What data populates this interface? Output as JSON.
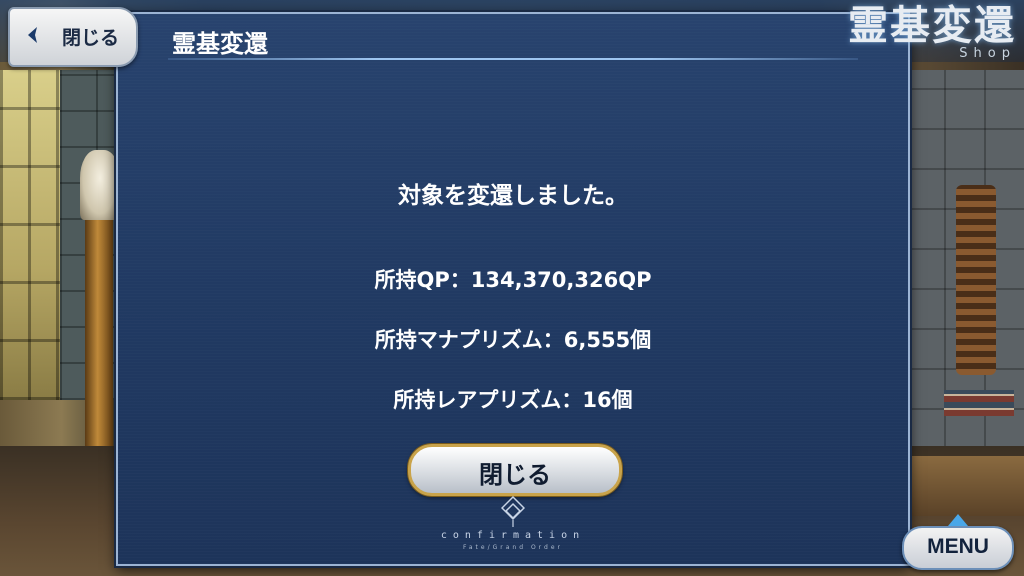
{
  "header": {
    "close_label": "閉じる",
    "shop_title": "霊基変還",
    "shop_subtitle": "Shop"
  },
  "dialog": {
    "title": "霊基変還",
    "message": "対象を変還しました。",
    "qp_line": "所持QP：134,370,326QP",
    "mana_prism_line": "所持マナプリズム：6,555個",
    "rare_prism_line": "所持レアプリズム：16個",
    "close_button": "閉じる",
    "footer_label": "confirmation",
    "footer_brand": "Fate/Grand Order"
  },
  "menu": {
    "label": "MENU"
  },
  "icons": {
    "back": "chevron-left-icon",
    "emblem": "fgo-emblem-icon",
    "menu_indicator": "triangle-up-icon"
  },
  "colors": {
    "dialog_bg": "#213a63",
    "dialog_border": "#9cb4d4",
    "button_gold": "#c9a34a",
    "menu_accent": "#4aa7e8"
  }
}
